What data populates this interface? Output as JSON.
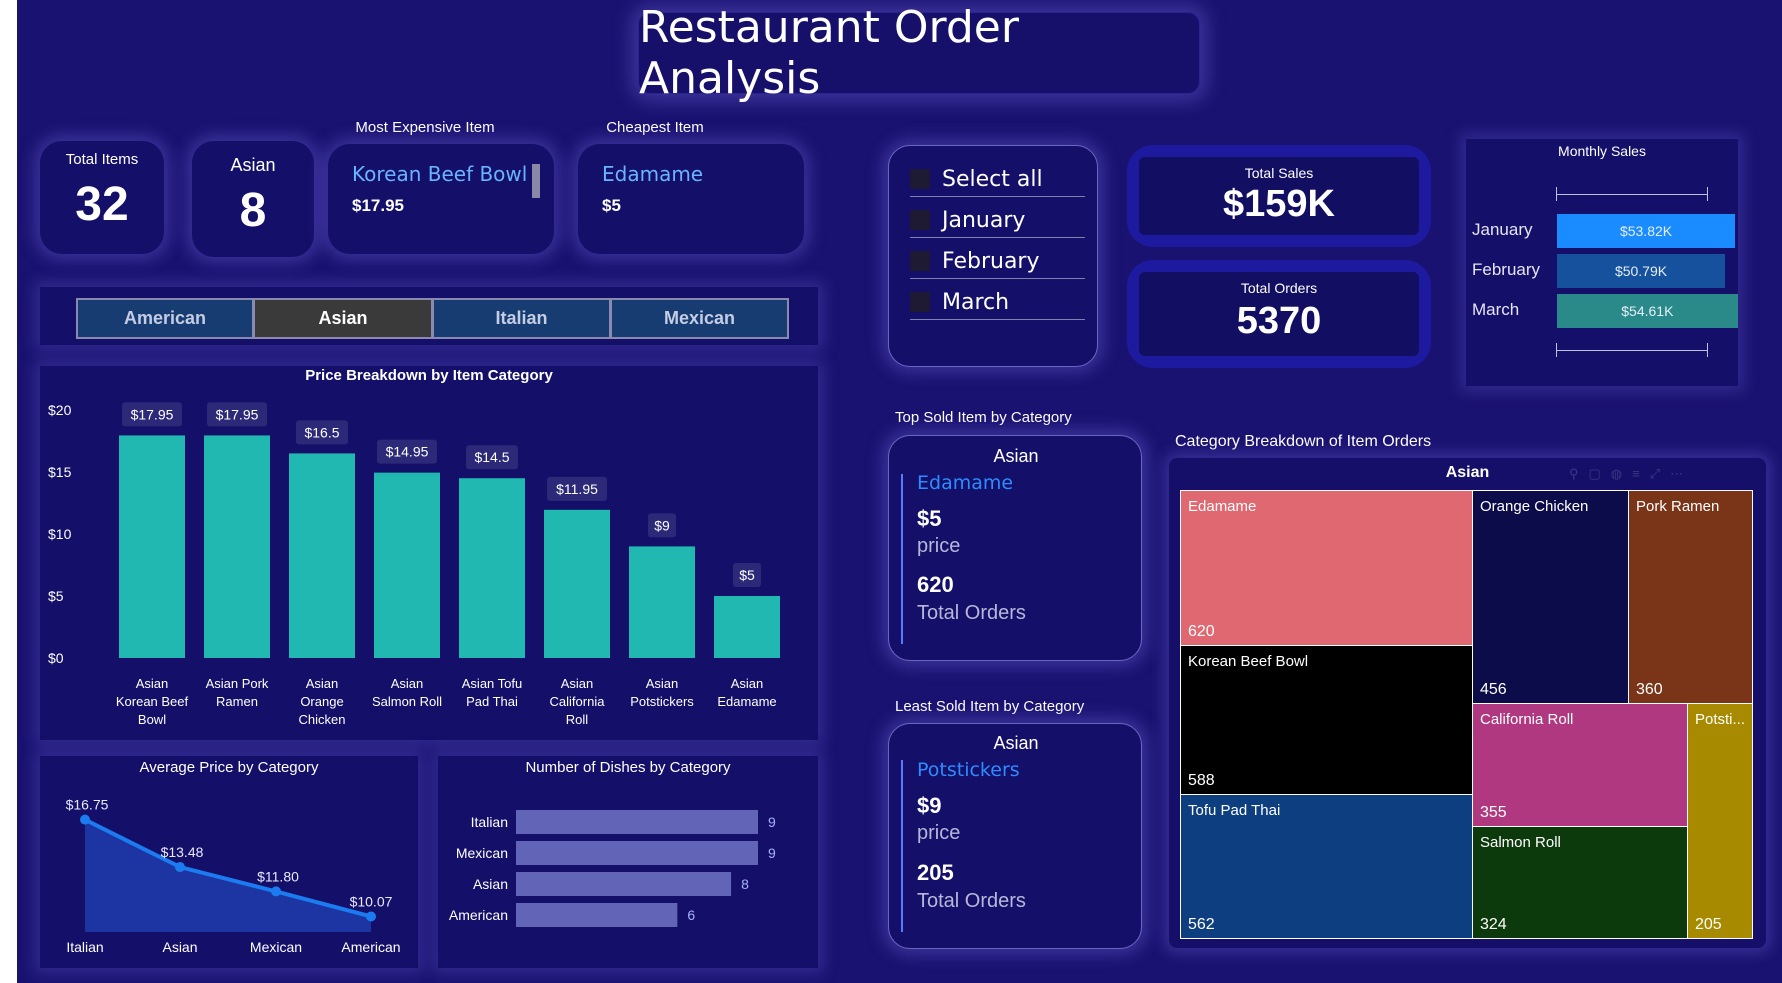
{
  "dashboard": {
    "title": "Restaurant Order Analysis"
  },
  "cards": {
    "total_items": {
      "label": "Total Items",
      "value": "32"
    },
    "selected_category": {
      "label": "Asian",
      "value": "8"
    },
    "most_expensive": {
      "heading": "Most Expensive Item",
      "name": "Korean Beef Bowl",
      "price": "$17.95"
    },
    "cheapest": {
      "heading": "Cheapest Item",
      "name": "Edamame",
      "price": "$5"
    }
  },
  "category_slicer": {
    "buttons": [
      "American",
      "Asian",
      "Italian",
      "Mexican"
    ],
    "selected": "Asian"
  },
  "month_slicer": {
    "items": [
      "Select all",
      "January",
      "February",
      "March"
    ]
  },
  "kpis": {
    "total_sales": {
      "label": "Total Sales",
      "value": "$159K"
    },
    "total_orders": {
      "label": "Total Orders",
      "value": "5370"
    }
  },
  "monthly_sales": {
    "title": "Monthly Sales",
    "rows": [
      {
        "label": "January",
        "value_label": "$53.82K",
        "value": 53.82,
        "color": "#1a8cff"
      },
      {
        "label": "February",
        "value_label": "$50.79K",
        "value": 50.79,
        "color": "#15519c"
      },
      {
        "label": "March",
        "value_label": "$54.61K",
        "value": 54.61,
        "color": "#2a8a8a"
      }
    ]
  },
  "top_sold": {
    "heading": "Top Sold Item by Category",
    "category": "Asian",
    "item": "Edamame",
    "price": "$5",
    "price_label": "price",
    "orders": "620",
    "orders_label": "Total Orders"
  },
  "least_sold": {
    "heading": "Least Sold Item by Category",
    "category": "Asian",
    "item": "Potstickers",
    "price": "$9",
    "price_label": "price",
    "orders": "205",
    "orders_label": "Total Orders"
  },
  "treemap": {
    "heading": "Category Breakdown of Item Orders",
    "title": "Asian",
    "cells": [
      {
        "name": "Edamame",
        "value": "620",
        "color": "#e06870"
      },
      {
        "name": "Orange Chicken",
        "value": "456",
        "color": "#0c0c4a"
      },
      {
        "name": "Pork Ramen",
        "value": "360",
        "color": "#7a3418"
      },
      {
        "name": "Korean Beef Bowl",
        "value": "588",
        "color": "#000000"
      },
      {
        "name": "California Roll",
        "value": "355",
        "color": "#b03880"
      },
      {
        "name": "Potsti...",
        "value": "205",
        "color": "#a88a00"
      },
      {
        "name": "Tofu Pad Thai",
        "value": "562",
        "color": "#0c3e80"
      },
      {
        "name": "Salmon Roll",
        "value": "324",
        "color": "#0c3a0c"
      }
    ]
  },
  "chart_data": [
    {
      "type": "bar",
      "title": "Price Breakdown by Item Category",
      "categories": [
        "Asian Korean Beef Bowl",
        "Asian Pork Ramen",
        "Asian Orange Chicken",
        "Asian Salmon Roll",
        "Asian Tofu Pad Thai",
        "Asian California Roll",
        "Asian Potstickers",
        "Asian Edamame"
      ],
      "category_lines": [
        [
          "Asian",
          "Korean Beef",
          "Bowl"
        ],
        [
          "Asian Pork",
          "Ramen"
        ],
        [
          "Asian",
          "Orange",
          "Chicken"
        ],
        [
          "Asian",
          "Salmon Roll"
        ],
        [
          "Asian Tofu",
          "Pad Thai"
        ],
        [
          "Asian",
          "California",
          "Roll"
        ],
        [
          "Asian",
          "Potstickers"
        ],
        [
          "Asian",
          "Edamame"
        ]
      ],
      "values": [
        17.95,
        17.95,
        16.5,
        14.95,
        14.5,
        11.95,
        9,
        5
      ],
      "data_labels": [
        "$17.95",
        "$17.95",
        "$16.5",
        "$14.95",
        "$14.5",
        "$11.95",
        "$9",
        "$5"
      ],
      "yticks": [
        "$0",
        "$5",
        "$10",
        "$15",
        "$20"
      ],
      "ylim": [
        0,
        20
      ],
      "color": "#20b8b0"
    },
    {
      "type": "area",
      "title": "Average Price by Category",
      "categories": [
        "Italian",
        "Asian",
        "Mexican",
        "American"
      ],
      "values": [
        16.75,
        13.48,
        11.8,
        10.07
      ],
      "data_labels": [
        "$16.75",
        "$13.48",
        "$11.80",
        "$10.07"
      ],
      "color": "#1a7cf0"
    },
    {
      "type": "bar",
      "orientation": "horizontal",
      "title": "Number of Dishes by Category",
      "categories": [
        "Italian",
        "Mexican",
        "Asian",
        "American"
      ],
      "values": [
        9,
        9,
        8,
        6
      ],
      "color": "#6264b8"
    }
  ]
}
